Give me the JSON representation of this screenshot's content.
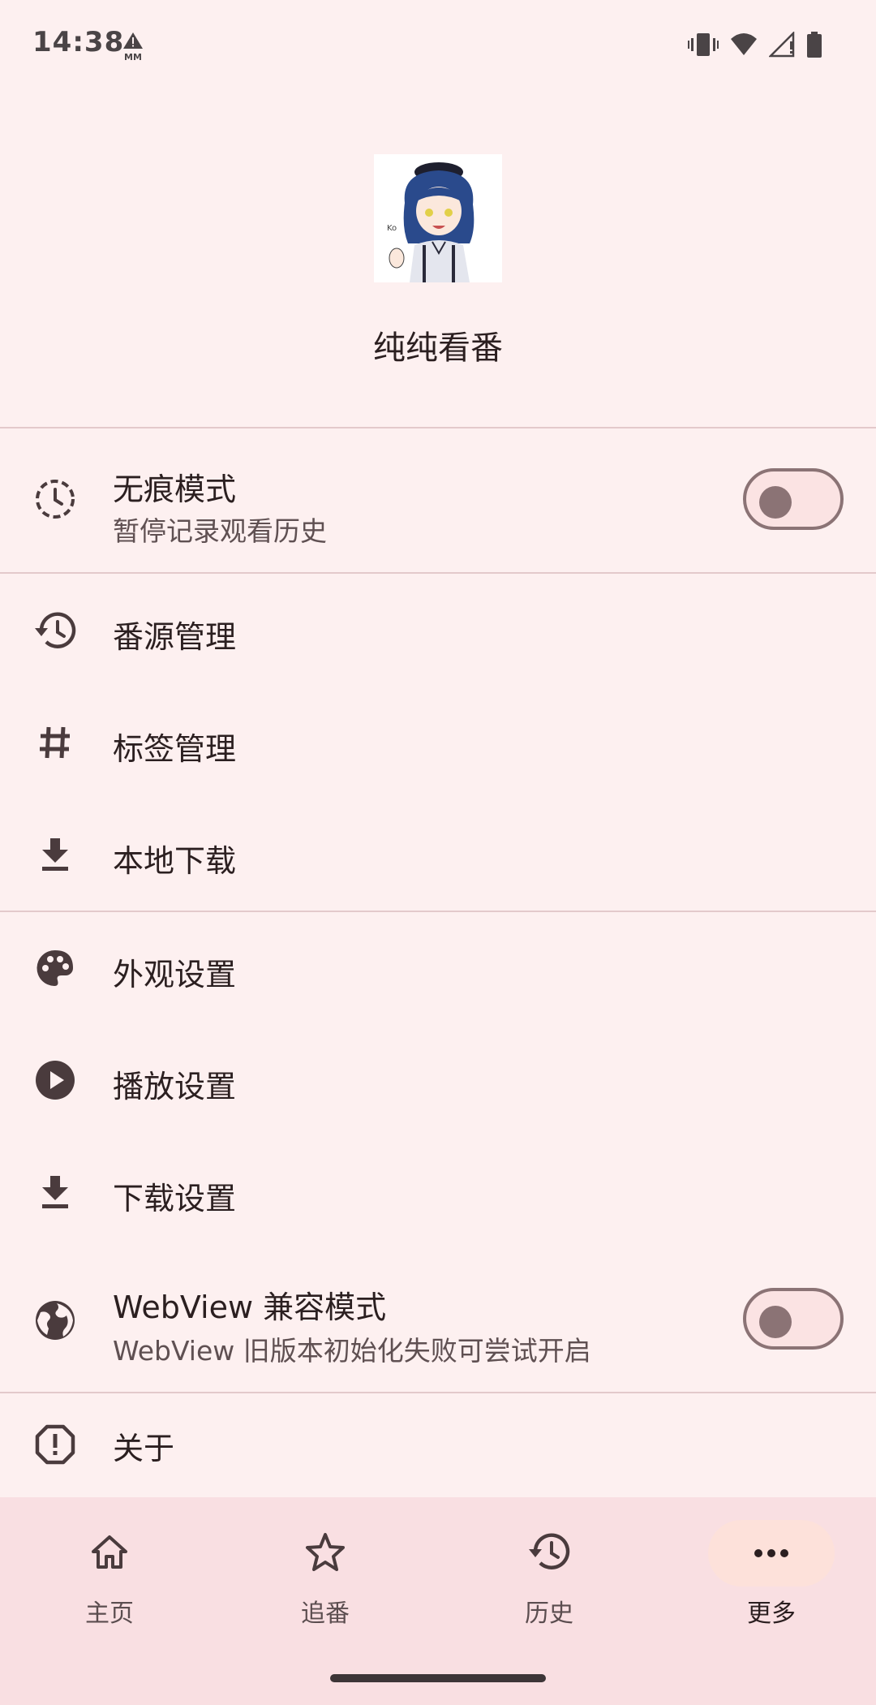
{
  "status_bar": {
    "time": "14:38",
    "left_icon": "alert-mm-icon",
    "right_icons": [
      "vibrate-icon",
      "wifi-icon",
      "signal-icon",
      "battery-icon"
    ]
  },
  "header": {
    "avatar": "anime-girl-avatar",
    "app_name": "纯纯看番"
  },
  "settings": {
    "incognito": {
      "title": "无痕模式",
      "subtitle": "暂停记录观看历史",
      "icon": "timer-dashed-icon",
      "toggle_on": false
    },
    "source_manage": {
      "title": "番源管理",
      "icon": "history-icon"
    },
    "tag_manage": {
      "title": "标签管理",
      "icon": "hashtag-icon"
    },
    "local_download": {
      "title": "本地下载",
      "icon": "download-icon"
    },
    "appearance": {
      "title": "外观设置",
      "icon": "palette-icon"
    },
    "playback": {
      "title": "播放设置",
      "icon": "play-circle-icon"
    },
    "download_settings": {
      "title": "下载设置",
      "icon": "download-icon"
    },
    "webview_compat": {
      "title": "WebView 兼容模式",
      "subtitle": "WebView 旧版本初始化失败可尝试开启",
      "icon": "globe-icon",
      "toggle_on": false
    },
    "about": {
      "title": "关于",
      "icon": "info-alert-icon"
    }
  },
  "bottom_nav": {
    "items": [
      {
        "label": "主页",
        "icon": "home-icon"
      },
      {
        "label": "追番",
        "icon": "star-icon"
      },
      {
        "label": "历史",
        "icon": "history-icon"
      },
      {
        "label": "更多",
        "icon": "more-horiz-icon"
      }
    ],
    "active_index": 3
  },
  "colors": {
    "background": "#fdf0f0",
    "nav_background": "#f9dfe2",
    "accent_pill": "#fde1da",
    "icon": "#4a3b3d",
    "toggle_outline": "#8b7375"
  }
}
